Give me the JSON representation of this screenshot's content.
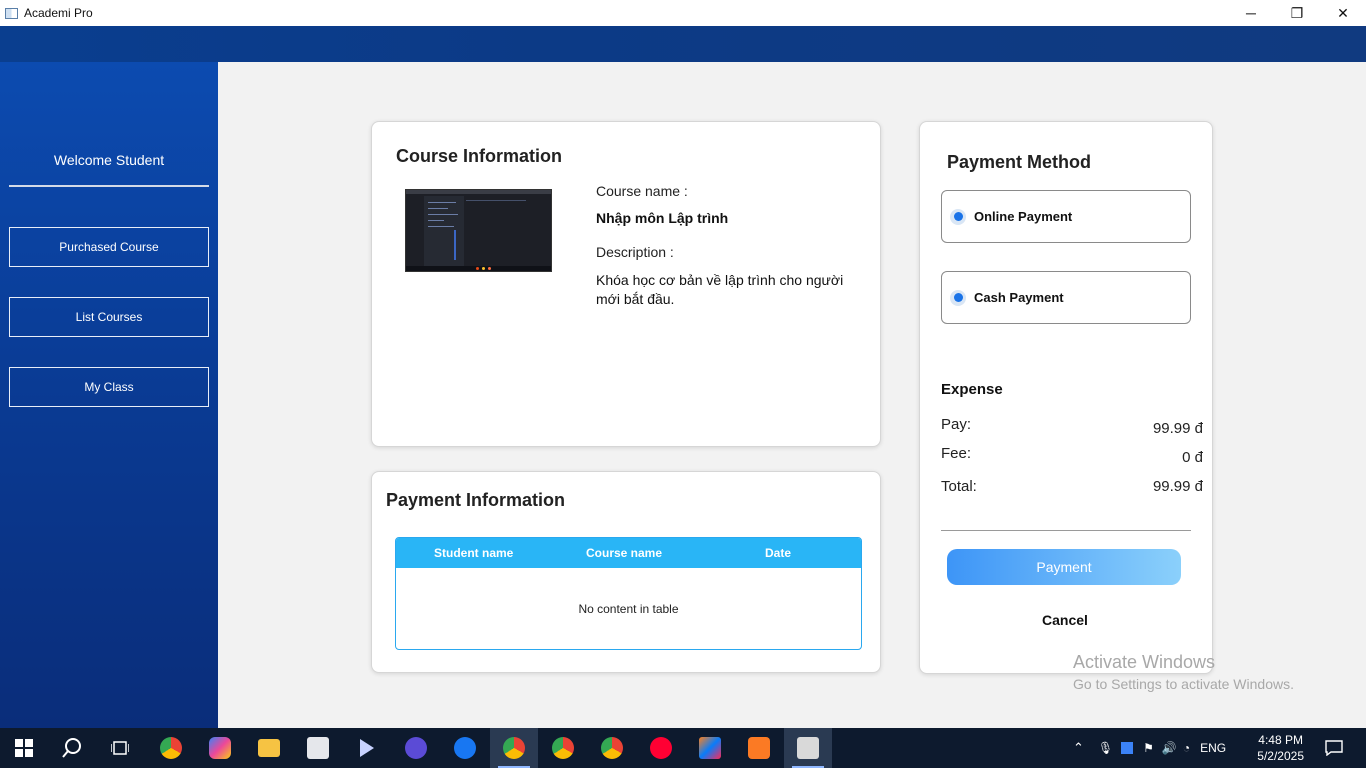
{
  "window": {
    "title": "Academi Pro",
    "controls": {
      "minimize": "─",
      "maximize": "❐",
      "close": "✕"
    }
  },
  "sidebar": {
    "welcome": "Welcome Student",
    "items": [
      {
        "label": "Purchased Course"
      },
      {
        "label": "List Courses"
      },
      {
        "label": "My Class"
      }
    ]
  },
  "course_info": {
    "title": "Course Information",
    "name_label": "Course name :",
    "name_value": "Nhập môn Lập trình",
    "description_label": "Description :",
    "description_value": "Khóa học cơ bản về lập trình cho người mới bắt đầu."
  },
  "payment_info": {
    "title": "Payment Information",
    "columns": [
      "Student name",
      "Course name",
      "Date"
    ],
    "empty_text": "No content in table"
  },
  "payment_method": {
    "title": "Payment Method",
    "options": [
      {
        "label": "Online Payment",
        "selected": true
      },
      {
        "label": "Cash Payment",
        "selected": true
      }
    ],
    "expense_title": "Expense",
    "rows": [
      {
        "label": "Pay:",
        "value": "99.99  đ"
      },
      {
        "label": "Fee:",
        "value": "0  đ"
      },
      {
        "label": "Total:",
        "value": "99.99  đ"
      }
    ],
    "pay_button": "Payment",
    "cancel_button": "Cancel"
  },
  "watermark": {
    "line1": "Activate Windows",
    "line2": "Go to Settings to activate Windows."
  },
  "taskbar": {
    "language": "ENG",
    "time": "4:48 PM",
    "date": "5/2/2025"
  },
  "colors": {
    "sidebar_blue": "#0a3c96",
    "table_header": "#29b5f6",
    "radio_selected": "#1a73e8",
    "pay_button": "#3d95f7"
  }
}
